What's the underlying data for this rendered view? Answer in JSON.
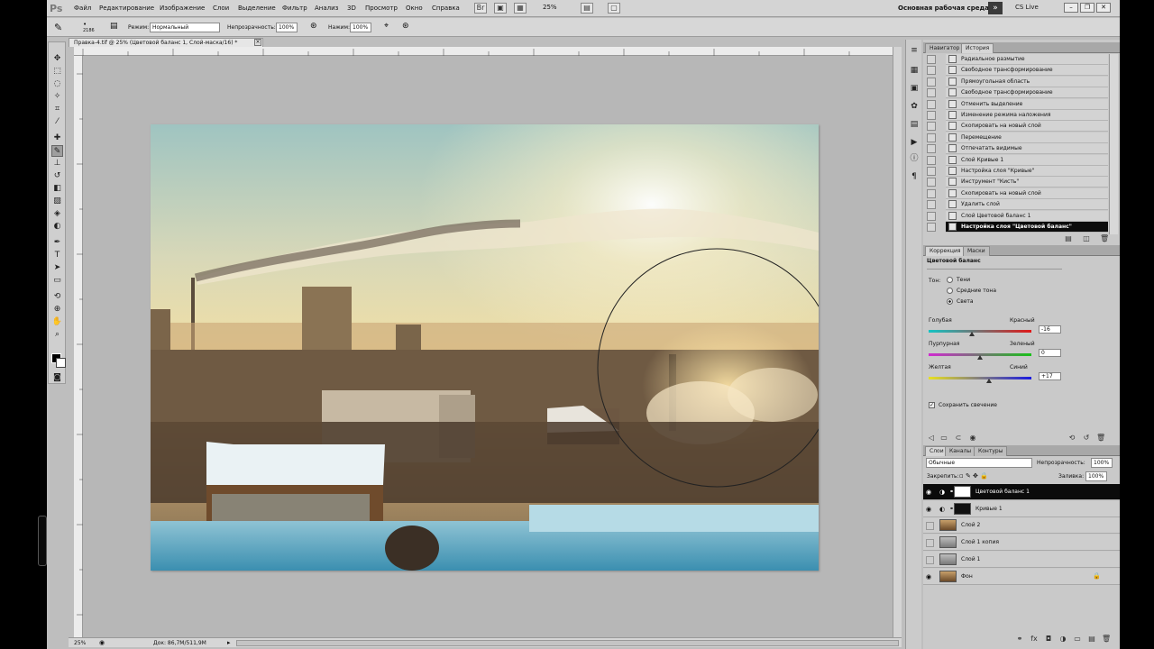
{
  "app": {
    "logo": "Ps"
  },
  "menu": [
    "Файл",
    "Редактирование",
    "Изображение",
    "Слои",
    "Выделение",
    "Фильтр",
    "Анализ",
    "3D",
    "Просмотр",
    "Окно",
    "Справка"
  ],
  "zoom_value": "25%",
  "workspace": {
    "label": "Основная рабочая среда",
    "arrow": "»"
  },
  "cslive": "CS Live",
  "options": {
    "brush_size": "2186",
    "mode_label": "Режим:",
    "mode_value": "Нормальный",
    "opacity_label": "Непрозрачность:",
    "opacity_value": "100%",
    "flow_label": "Нажим:",
    "flow_value": "100%"
  },
  "document": {
    "tab_title": "Правка-4.tif @ 25% (Цветовой баланс 1, Слой-маска/16) *",
    "close": "×",
    "status_zoom": "25%",
    "status_doc": "Док: 86,7M/511,9M"
  },
  "history": {
    "tabs": [
      "Навигатор",
      "История"
    ],
    "items": [
      {
        "label": "Радиальное размытие",
        "icon": "filter-icon"
      },
      {
        "label": "Свободное трансформирование",
        "icon": "transform-icon"
      },
      {
        "label": "Прямоугольная область",
        "icon": "marquee-icon"
      },
      {
        "label": "Свободное трансформирование",
        "icon": "transform-icon"
      },
      {
        "label": "Отменить выделение",
        "icon": "deselect-icon"
      },
      {
        "label": "Изменение режима наложения",
        "icon": "blend-icon"
      },
      {
        "label": "Скопировать на новый слой",
        "icon": "layer-icon"
      },
      {
        "label": "Перемещение",
        "icon": "move-icon"
      },
      {
        "label": "Отпечатать видимые",
        "icon": "stamp-icon"
      },
      {
        "label": "Слой Кривые 1",
        "icon": "layer-icon"
      },
      {
        "label": "Настройка слоя \"Кривые\"",
        "icon": "layer-icon"
      },
      {
        "label": "Инструмент \"Кисть\"",
        "icon": "brush-icon"
      },
      {
        "label": "Скопировать на новый слой",
        "icon": "layer-icon"
      },
      {
        "label": "Удалить слой",
        "icon": "layer-icon"
      },
      {
        "label": "Слой Цветовой баланс 1",
        "icon": "layer-icon"
      },
      {
        "label": "Настройка слоя \"Цветовой баланс\"",
        "icon": "layer-icon",
        "selected": true
      }
    ]
  },
  "adjust": {
    "tabs": [
      "Коррекция",
      "Маски"
    ],
    "title": "Цветовой баланс",
    "tone_label": "Тон:",
    "tones": [
      "Тени",
      "Средние тона",
      "Света"
    ],
    "selected_tone": "Света",
    "sliders": [
      {
        "left": "Голубая",
        "right": "Красный",
        "value": "-16",
        "level": -16,
        "colors": [
          "#14c4c4",
          "#e01818"
        ]
      },
      {
        "left": "Пурпурная",
        "right": "Зеленый",
        "value": "0",
        "level": 0,
        "colors": [
          "#d02ad0",
          "#18c018"
        ]
      },
      {
        "left": "Желтая",
        "right": "Синий",
        "value": "+17",
        "level": 17,
        "colors": [
          "#e8e020",
          "#1a1ae0"
        ]
      }
    ],
    "preserve_label": "Сохранить свечение",
    "preserve_checked": true
  },
  "layers": {
    "tabs": [
      "Слои",
      "Каналы",
      "Контуры"
    ],
    "blend_mode": "Обычные",
    "opacity_label": "Непрозрачность:",
    "opacity_value": "100%",
    "lock_label": "Закрепить:",
    "fill_label": "Заливка:",
    "fill_value": "100%",
    "items": [
      {
        "name": "Цветовой баланс 1",
        "visible": true,
        "selected": true,
        "kind": "adjust"
      },
      {
        "name": "Кривые 1",
        "visible": true,
        "selected": false,
        "kind": "curves"
      },
      {
        "name": "Слой 2",
        "visible": false,
        "selected": false,
        "kind": "photo"
      },
      {
        "name": "Слой 1 копия",
        "visible": false,
        "selected": false,
        "kind": "photo-gray"
      },
      {
        "name": "Слой 1",
        "visible": false,
        "selected": false,
        "kind": "photo-gray"
      },
      {
        "name": "Фон",
        "visible": true,
        "selected": false,
        "kind": "photo",
        "locked": true
      }
    ]
  }
}
